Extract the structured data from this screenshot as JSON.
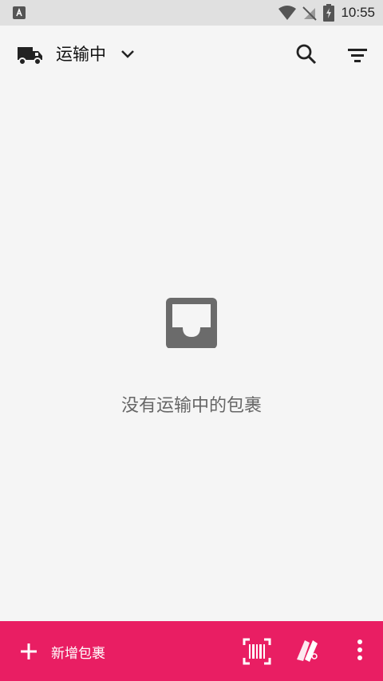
{
  "status_bar": {
    "time": "10:55"
  },
  "toolbar": {
    "title": "运输中"
  },
  "empty_state": {
    "message": "没有运输中的包裹"
  },
  "bottom_bar": {
    "add_label": "新增包裹"
  },
  "colors": {
    "accent": "#e91e63",
    "background": "#f5f5f5",
    "status_bar": "#e0e0e0"
  },
  "icons": [
    "app-notification-icon",
    "wifi-icon",
    "no-signal-icon",
    "battery-icon",
    "truck-icon",
    "chevron-down-icon",
    "search-icon",
    "filter-icon",
    "inbox-icon",
    "plus-icon",
    "barcode-scan-icon",
    "paint-icon",
    "more-vert-icon"
  ]
}
